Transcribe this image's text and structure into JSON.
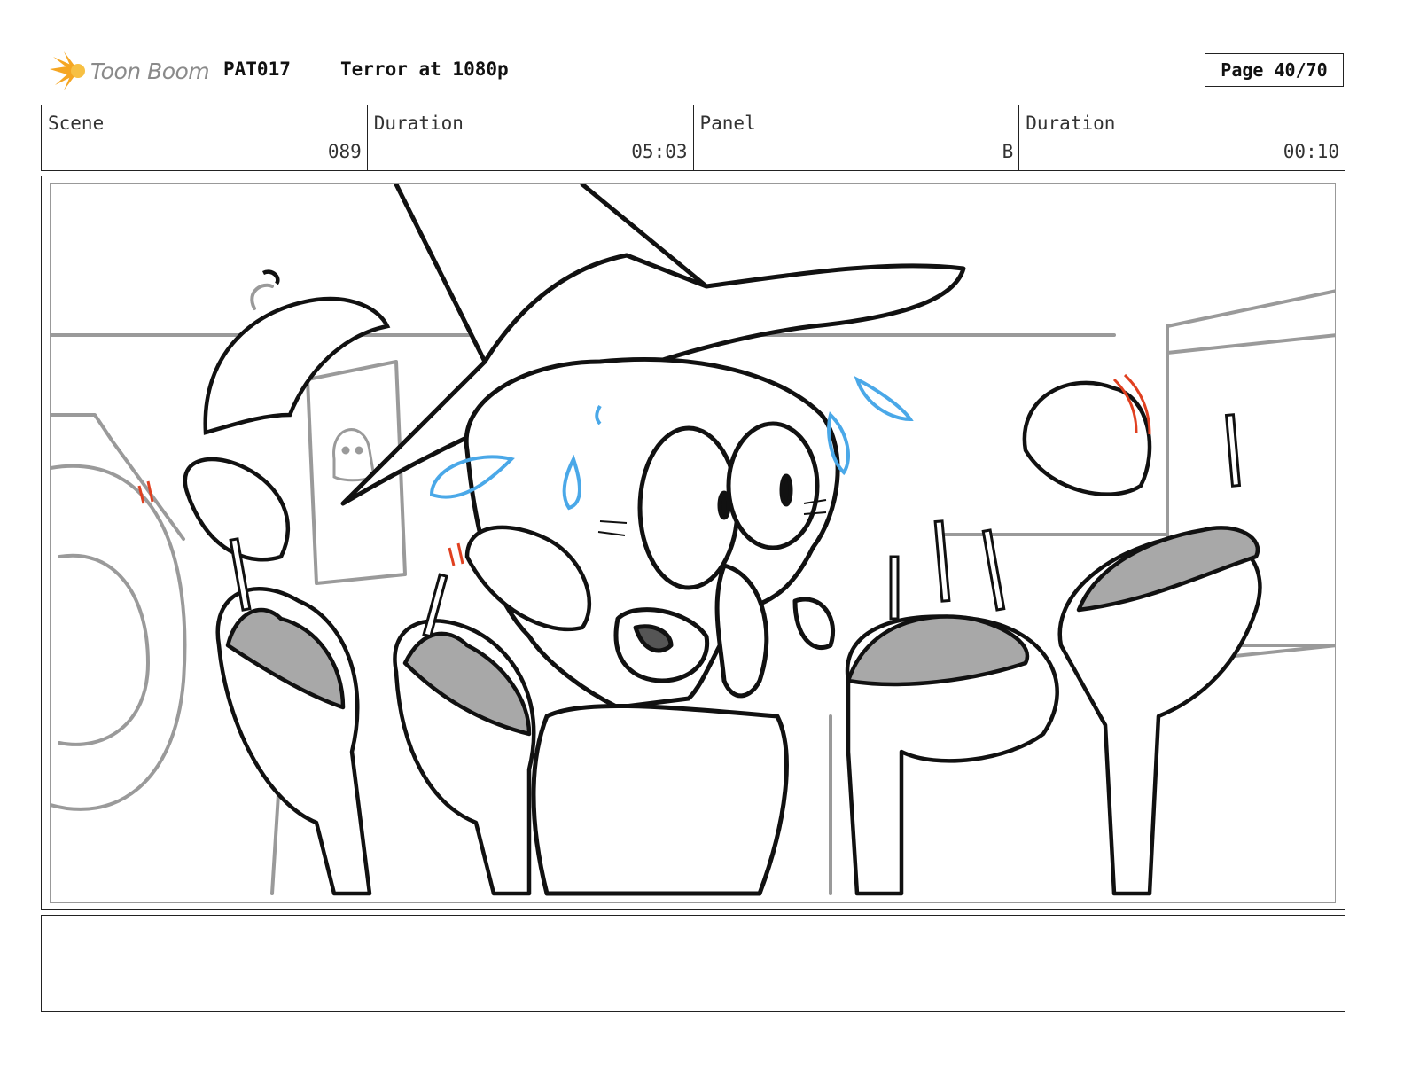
{
  "header": {
    "logo_text": "Toon Boom",
    "project_code": "PAT017",
    "project_title": "Terror at 1080p",
    "page": "Page 40/70"
  },
  "info": {
    "scene_label": "Scene",
    "scene_value": "089",
    "scene_duration_label": "Duration",
    "scene_duration_value": "05:03",
    "panel_label": "Panel",
    "panel_value": "B",
    "panel_duration_label": "Duration",
    "panel_duration_value": "00:10"
  },
  "colors": {
    "sweat": "#4aa8e8",
    "shake_marks": "#e04020",
    "food_fill": "#a8a8a8",
    "logo_orange": "#f5a623"
  }
}
